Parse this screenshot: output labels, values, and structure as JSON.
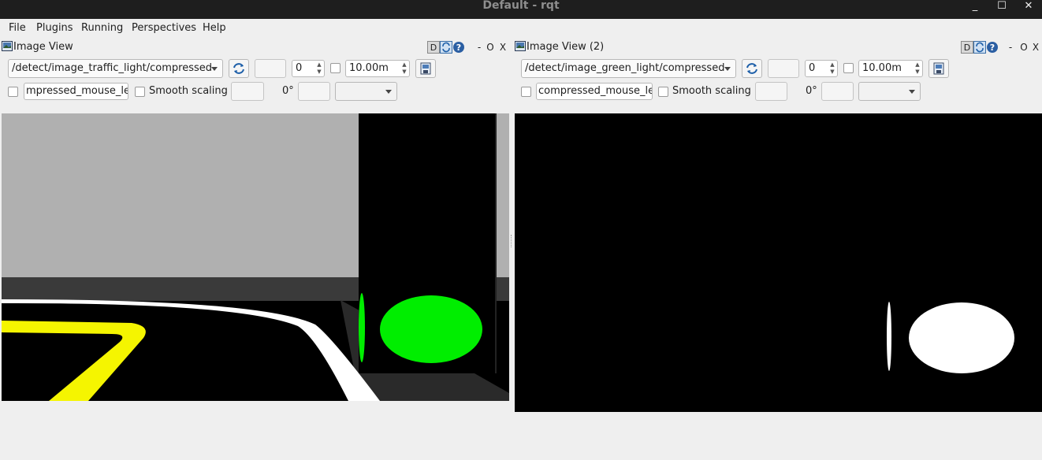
{
  "window": {
    "title": "Default - rqt",
    "minimize": "_",
    "maximize": "☐",
    "close": "✕"
  },
  "menu": {
    "file": "File",
    "plugins": "Plugins",
    "running": "Running",
    "perspectives": "Perspectives",
    "help": "Help"
  },
  "panels": [
    {
      "title": "Image View",
      "dock_d": "D",
      "dock_o": "O",
      "dock_x": "X",
      "topic": "/detect/image_traffic_light/compressed",
      "spin_value": "0",
      "timeout": "10.00m",
      "mouse_topic": "mpressed_mouse_left",
      "smooth_label": "Smooth scaling",
      "rotation": "0°"
    },
    {
      "title": "Image View (2)",
      "dock_d": "D",
      "dock_o": "O",
      "dock_x": "X",
      "topic": "/detect/image_green_light/compressed",
      "spin_value": "0",
      "timeout": "10.00m",
      "mouse_topic": "compressed_mouse_left",
      "smooth_label": "Smooth scaling",
      "rotation": "0°"
    }
  ],
  "colors": {
    "traffic_light_green": "#00ee00",
    "lane_yellow": "#f5f500",
    "lane_white": "#ffffff"
  }
}
